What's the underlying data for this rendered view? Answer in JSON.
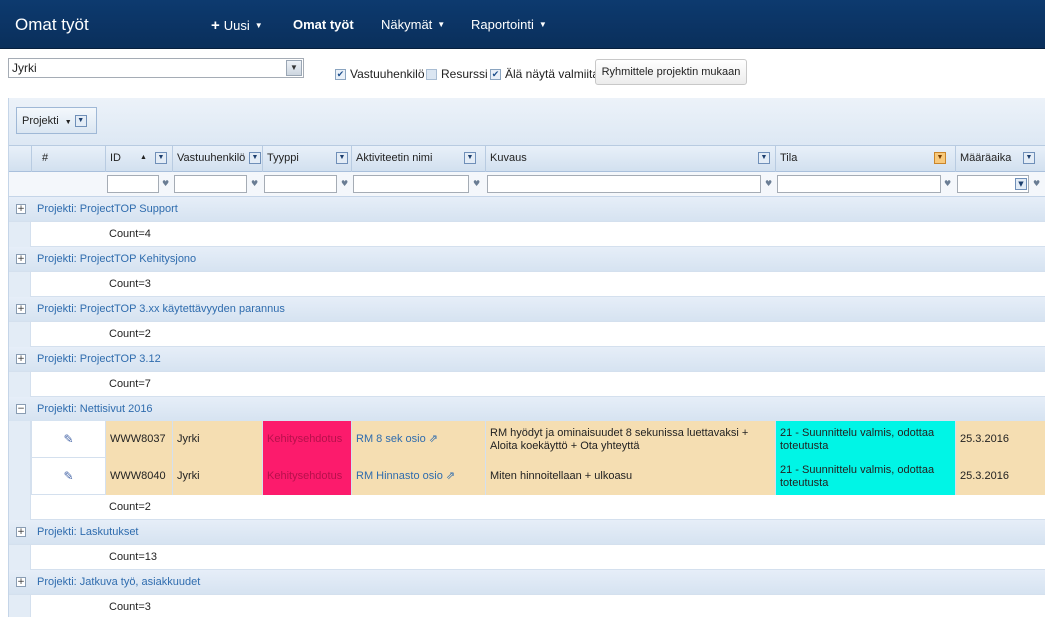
{
  "navbar": {
    "brand": "Omat työt",
    "items": [
      {
        "label": "Uusi",
        "has_plus": true
      },
      {
        "label": "Omat työt"
      },
      {
        "label": "Näkymät"
      },
      {
        "label": "Raportointi"
      }
    ]
  },
  "toolbar": {
    "user_select": "Jyrki",
    "checkboxes": [
      {
        "label": "Vastuuhenkilö",
        "checked": true
      },
      {
        "label": "Resurssi",
        "checked": false
      },
      {
        "label": "Älä näytä valmiita",
        "checked": true
      }
    ],
    "group_button": "Ryhmittele projektin mukaan"
  },
  "group_panel": {
    "chip": "Projekti"
  },
  "columns": [
    "#",
    "ID",
    "Vastuuhenkilö",
    "Tyyppi",
    "Aktiviteetin nimi",
    "Kuvaus",
    "Tila",
    "Määräaika"
  ],
  "groups": [
    {
      "title": "Projekti: ProjectTOP Support",
      "count": "Count=4",
      "expanded": false
    },
    {
      "title": "Projekti: ProjectTOP Kehitysjono",
      "count": "Count=3",
      "expanded": false
    },
    {
      "title": "Projekti: ProjectTOP 3.xx käytettävyyden parannus",
      "count": "Count=2",
      "expanded": false
    },
    {
      "title": "Projekti: ProjectTOP 3.12",
      "count": "Count=7",
      "expanded": false
    },
    {
      "title": "Projekti: Nettisivut 2016",
      "count": "Count=2",
      "expanded": true
    },
    {
      "title": "Projekti: Laskutukset",
      "count": "Count=13",
      "expanded": false
    },
    {
      "title": "Projekti: Jatkuva työ, asiakkuudet",
      "count": "Count=3",
      "expanded": false
    }
  ],
  "rows": [
    {
      "id": "WWW8037",
      "owner": "Jyrki",
      "type": "Kehitysehdotus",
      "activity": "RM 8 sek osio",
      "desc1": "RM hyödyt ja ominaisuudet 8 sekunissa luettavaksi +",
      "desc2": "Aloita koekäyttö + Ota yhteyttä",
      "status1": "21 - Suunnittelu valmis, odottaa",
      "status2": "toteutusta",
      "due": "25.3.2016"
    },
    {
      "id": "WWW8040",
      "owner": "Jyrki",
      "type": "Kehitysehdotus",
      "activity": "RM Hinnasto osio",
      "desc1": "Miten hinnoitellaan + ulkoasu",
      "desc2": "",
      "status1": "21 - Suunnittelu valmis, odottaa",
      "status2": "toteutusta",
      "due": "25.3.2016"
    }
  ],
  "colors": {
    "tan": "#f5deb2",
    "pink": "#fc1b6c",
    "cyan": "#00f5e6",
    "navbar": "#0d3a6f"
  }
}
